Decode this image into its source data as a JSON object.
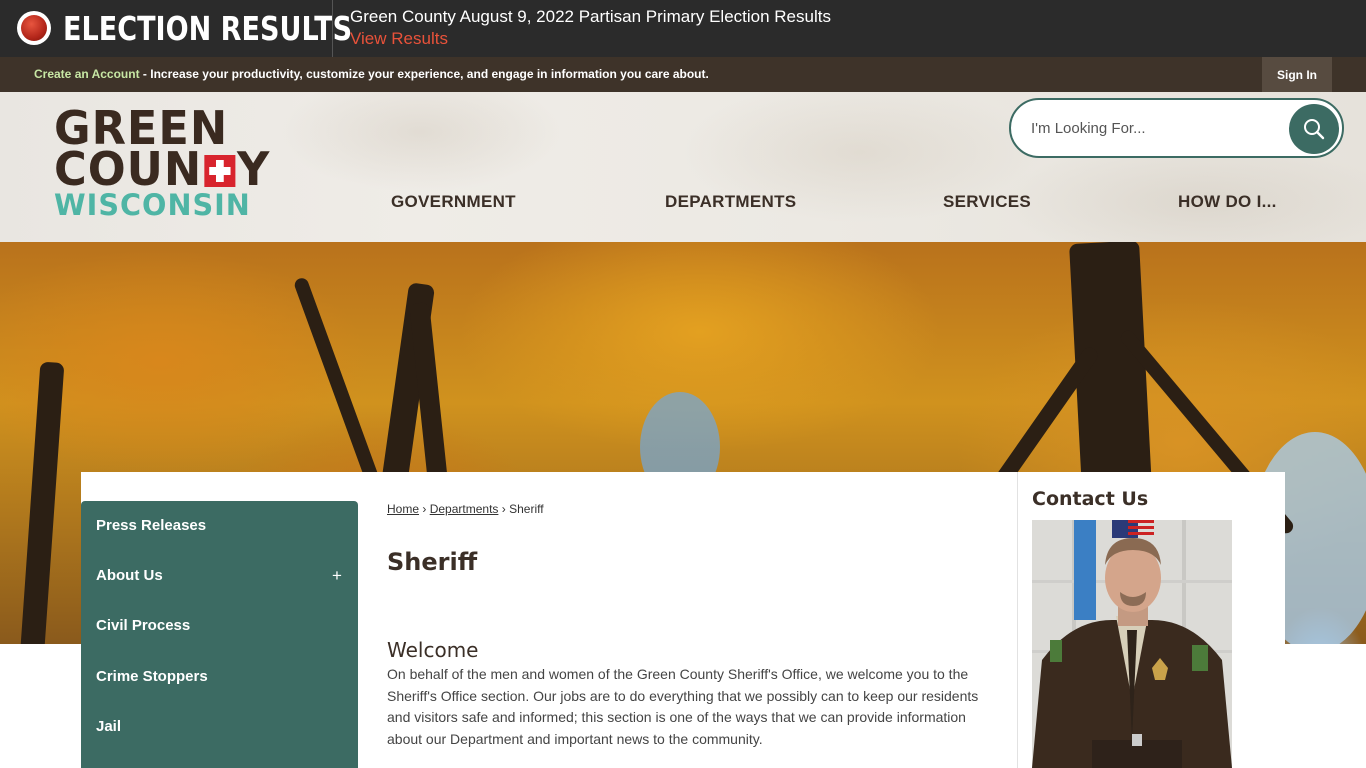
{
  "alert": {
    "title": "ELECTION RESULTS",
    "headline": "Green County August 9, 2022 Partisan Primary Election Results",
    "link": "View Results"
  },
  "account_bar": {
    "create_label": "Create an Account",
    "text": " - Increase your productivity, customize your experience, and engage in information you care about.",
    "sign_in": "Sign In"
  },
  "logo": {
    "line1": "GREEN",
    "line2_a": "COUN",
    "line2_b": "Y",
    "line3": "WISCONSIN"
  },
  "search": {
    "placeholder": "I'm Looking For..."
  },
  "nav": [
    "GOVERNMENT",
    "DEPARTMENTS",
    "SERVICES",
    "HOW DO I..."
  ],
  "sidebar": {
    "items": [
      "Press Releases",
      "About Us",
      "Civil Process",
      "Crime Stoppers",
      "Jail"
    ],
    "expand_symbol": "+"
  },
  "breadcrumb": {
    "home": "Home",
    "sep1": "›",
    "departments": "Departments",
    "sep2": "›",
    "current": "Sheriff"
  },
  "main": {
    "title": "Sheriff",
    "welcome_heading": "Welcome",
    "welcome_text": "On behalf of the men and women of the Green County Sheriff's Office, we welcome you to the Sheriff's Office section. Our jobs are to do everything that we possibly can to keep our residents and visitors safe and informed; this section is one of the ways that we can provide information about our Department and important news to the community."
  },
  "contact": {
    "title": "Contact Us"
  },
  "colors": {
    "brand_teal": "#3c6b63",
    "brand_brown": "#3b2f27",
    "alert_red": "#e8523a",
    "logo_red": "#d8242d",
    "logo_teal": "#4fb5a5"
  }
}
